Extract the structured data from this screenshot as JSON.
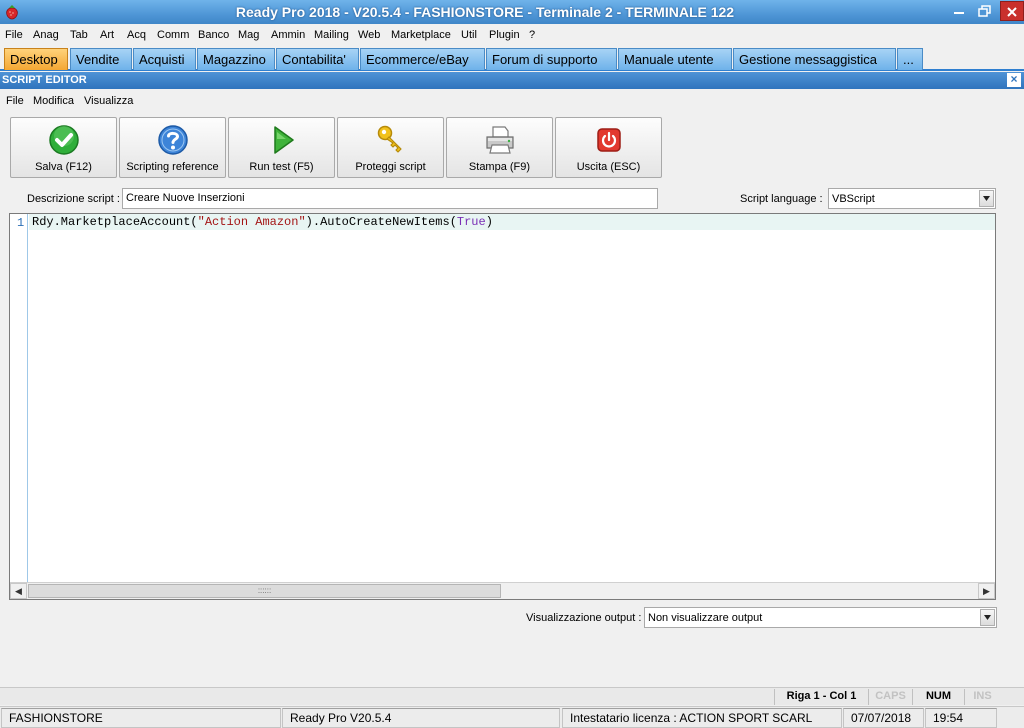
{
  "window": {
    "title": "Ready Pro 2018 - V20.5.4 - FASHIONSTORE - Terminale 2 - TERMINALE 122",
    "app_icon": "strawberry-icon"
  },
  "menu": [
    {
      "label": "File"
    },
    {
      "label": "Anag"
    },
    {
      "label": "Tab"
    },
    {
      "label": "Art"
    },
    {
      "label": "Acq"
    },
    {
      "label": "Comm"
    },
    {
      "label": "Banco"
    },
    {
      "label": "Mag"
    },
    {
      "label": "Ammin"
    },
    {
      "label": "Mailing"
    },
    {
      "label": "Web"
    },
    {
      "label": "Marketplace"
    },
    {
      "label": "Util"
    },
    {
      "label": "Plugin"
    },
    {
      "label": "?"
    }
  ],
  "tabs": [
    {
      "label": "Desktop",
      "active": true
    },
    {
      "label": "Vendite"
    },
    {
      "label": "Acquisti"
    },
    {
      "label": "Magazzino"
    },
    {
      "label": "Contabilita'"
    },
    {
      "label": "Ecommerce/eBay"
    },
    {
      "label": "Forum di supporto"
    },
    {
      "label": "Manuale utente"
    },
    {
      "label": "Gestione messaggistica"
    },
    {
      "label": "..."
    }
  ],
  "panel": {
    "title": "SCRIPT EDITOR",
    "close": "×"
  },
  "submenu": [
    {
      "label": "File"
    },
    {
      "label": "Modifica"
    },
    {
      "label": "Visualizza"
    }
  ],
  "toolbar": {
    "save": "Salva (F12)",
    "reference": "Scripting reference",
    "run": "Run test (F5)",
    "protect": "Proteggi script",
    "print": "Stampa (F9)",
    "exit": "Uscita (ESC)"
  },
  "form": {
    "description_label": "Descrizione script :",
    "description_value": "Creare Nuove Inserzioni",
    "language_label": "Script language :",
    "language_value": "VBScript",
    "output_label": "Visualizzazione output :",
    "output_value": "Non visualizzare output"
  },
  "editor": {
    "line_number": "1",
    "code_prefix": "Rdy.MarketplaceAccount(",
    "code_string": "\"Action Amazon\"",
    "code_middle": ").AutoCreateNewItems(",
    "code_keyword": "True",
    "code_suffix": ")",
    "grip": "::::::"
  },
  "status": {
    "position": "Riga 1 - Col 1",
    "caps": "CAPS",
    "num": "NUM",
    "ins": "INS",
    "company": "FASHIONSTORE",
    "version": "Ready Pro V20.5.4",
    "license": "Intestatario licenza : ACTION SPORT SCARL",
    "date": "07/07/2018",
    "time": "19:54"
  },
  "colors": {
    "titlebar": "#4f96d6",
    "active_tab": "#f4a733",
    "tab": "#6eb2ea",
    "panel_header": "#2f74bd"
  }
}
